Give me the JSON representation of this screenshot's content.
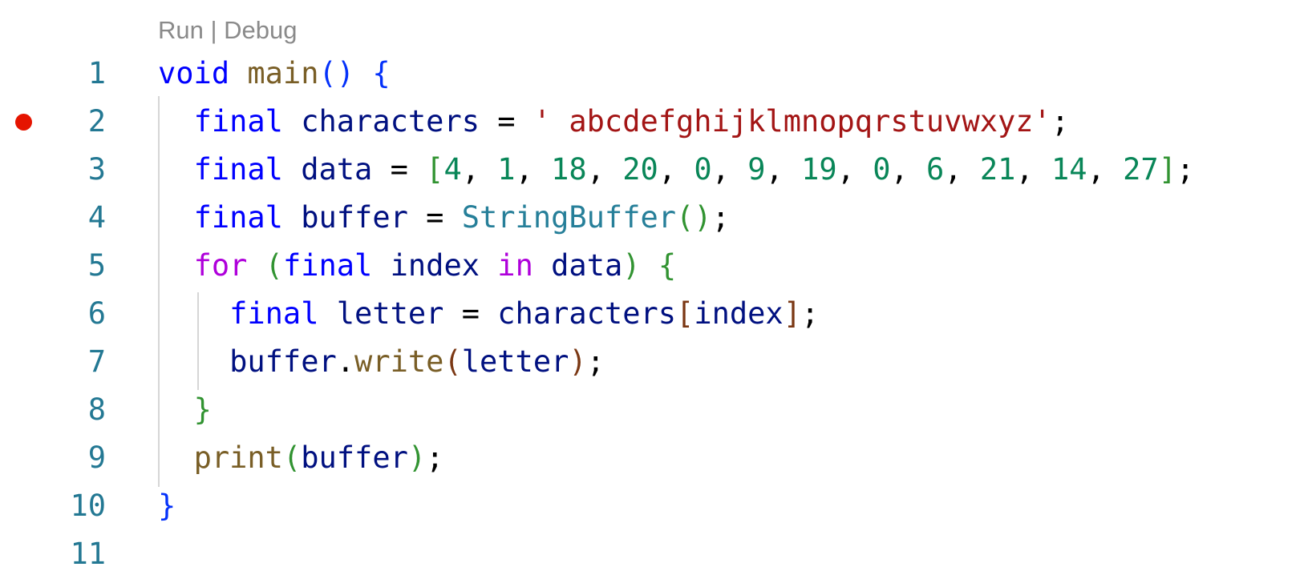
{
  "codelens": {
    "run_label": "Run",
    "separator": " | ",
    "debug_label": "Debug"
  },
  "breakpoint": {
    "line": 2,
    "color": "#e51400"
  },
  "colors": {
    "line_number": "#237893",
    "keyword": "#0000ff",
    "control": "#af00db",
    "function": "#795e26",
    "type": "#267f99",
    "variable": "#001080",
    "string": "#a31515",
    "number": "#098658",
    "bracket1": "#0431fa",
    "bracket2": "#319331",
    "bracket3": "#7b3814"
  },
  "lines": [
    {
      "number": "1",
      "tokens": [
        {
          "t": "void",
          "c": "kw"
        },
        {
          "t": " ",
          "c": "p"
        },
        {
          "t": "main",
          "c": "fn"
        },
        {
          "t": "()",
          "c": "b1"
        },
        {
          "t": " ",
          "c": "p"
        },
        {
          "t": "{",
          "c": "b1"
        }
      ]
    },
    {
      "number": "2",
      "tokens": [
        {
          "t": "  ",
          "c": "p"
        },
        {
          "t": "final",
          "c": "kw"
        },
        {
          "t": " ",
          "c": "p"
        },
        {
          "t": "characters",
          "c": "var"
        },
        {
          "t": " = ",
          "c": "p"
        },
        {
          "t": "' abcdefghijklmnopqrstuvwxyz'",
          "c": "str"
        },
        {
          "t": ";",
          "c": "p"
        }
      ]
    },
    {
      "number": "3",
      "tokens": [
        {
          "t": "  ",
          "c": "p"
        },
        {
          "t": "final",
          "c": "kw"
        },
        {
          "t": " ",
          "c": "p"
        },
        {
          "t": "data",
          "c": "var"
        },
        {
          "t": " = ",
          "c": "p"
        },
        {
          "t": "[",
          "c": "b2"
        },
        {
          "t": "4",
          "c": "num"
        },
        {
          "t": ", ",
          "c": "p"
        },
        {
          "t": "1",
          "c": "num"
        },
        {
          "t": ", ",
          "c": "p"
        },
        {
          "t": "18",
          "c": "num"
        },
        {
          "t": ", ",
          "c": "p"
        },
        {
          "t": "20",
          "c": "num"
        },
        {
          "t": ", ",
          "c": "p"
        },
        {
          "t": "0",
          "c": "num"
        },
        {
          "t": ", ",
          "c": "p"
        },
        {
          "t": "9",
          "c": "num"
        },
        {
          "t": ", ",
          "c": "p"
        },
        {
          "t": "19",
          "c": "num"
        },
        {
          "t": ", ",
          "c": "p"
        },
        {
          "t": "0",
          "c": "num"
        },
        {
          "t": ", ",
          "c": "p"
        },
        {
          "t": "6",
          "c": "num"
        },
        {
          "t": ", ",
          "c": "p"
        },
        {
          "t": "21",
          "c": "num"
        },
        {
          "t": ", ",
          "c": "p"
        },
        {
          "t": "14",
          "c": "num"
        },
        {
          "t": ", ",
          "c": "p"
        },
        {
          "t": "27",
          "c": "num"
        },
        {
          "t": "]",
          "c": "b2"
        },
        {
          "t": ";",
          "c": "p"
        }
      ]
    },
    {
      "number": "4",
      "tokens": [
        {
          "t": "  ",
          "c": "p"
        },
        {
          "t": "final",
          "c": "kw"
        },
        {
          "t": " ",
          "c": "p"
        },
        {
          "t": "buffer",
          "c": "var"
        },
        {
          "t": " = ",
          "c": "p"
        },
        {
          "t": "StringBuffer",
          "c": "type"
        },
        {
          "t": "()",
          "c": "b2"
        },
        {
          "t": ";",
          "c": "p"
        }
      ]
    },
    {
      "number": "5",
      "tokens": [
        {
          "t": "  ",
          "c": "p"
        },
        {
          "t": "for",
          "c": "ctl"
        },
        {
          "t": " ",
          "c": "p"
        },
        {
          "t": "(",
          "c": "b2"
        },
        {
          "t": "final",
          "c": "kw"
        },
        {
          "t": " ",
          "c": "p"
        },
        {
          "t": "index",
          "c": "var"
        },
        {
          "t": " ",
          "c": "p"
        },
        {
          "t": "in",
          "c": "ctl"
        },
        {
          "t": " ",
          "c": "p"
        },
        {
          "t": "data",
          "c": "var"
        },
        {
          "t": ")",
          "c": "b2"
        },
        {
          "t": " ",
          "c": "p"
        },
        {
          "t": "{",
          "c": "b2"
        }
      ]
    },
    {
      "number": "6",
      "tokens": [
        {
          "t": "    ",
          "c": "p"
        },
        {
          "t": "final",
          "c": "kw"
        },
        {
          "t": " ",
          "c": "p"
        },
        {
          "t": "letter",
          "c": "var"
        },
        {
          "t": " = ",
          "c": "p"
        },
        {
          "t": "characters",
          "c": "var"
        },
        {
          "t": "[",
          "c": "b3"
        },
        {
          "t": "index",
          "c": "var"
        },
        {
          "t": "]",
          "c": "b3"
        },
        {
          "t": ";",
          "c": "p"
        }
      ]
    },
    {
      "number": "7",
      "tokens": [
        {
          "t": "    ",
          "c": "p"
        },
        {
          "t": "buffer",
          "c": "var"
        },
        {
          "t": ".",
          "c": "p"
        },
        {
          "t": "write",
          "c": "fn"
        },
        {
          "t": "(",
          "c": "b3"
        },
        {
          "t": "letter",
          "c": "var"
        },
        {
          "t": ")",
          "c": "b3"
        },
        {
          "t": ";",
          "c": "p"
        }
      ]
    },
    {
      "number": "8",
      "tokens": [
        {
          "t": "  ",
          "c": "p"
        },
        {
          "t": "}",
          "c": "b2"
        }
      ]
    },
    {
      "number": "9",
      "tokens": [
        {
          "t": "  ",
          "c": "p"
        },
        {
          "t": "print",
          "c": "fn"
        },
        {
          "t": "(",
          "c": "b2"
        },
        {
          "t": "buffer",
          "c": "var"
        },
        {
          "t": ")",
          "c": "b2"
        },
        {
          "t": ";",
          "c": "p"
        }
      ]
    },
    {
      "number": "10",
      "tokens": [
        {
          "t": "}",
          "c": "b1"
        }
      ]
    },
    {
      "number": "11",
      "tokens": []
    }
  ]
}
